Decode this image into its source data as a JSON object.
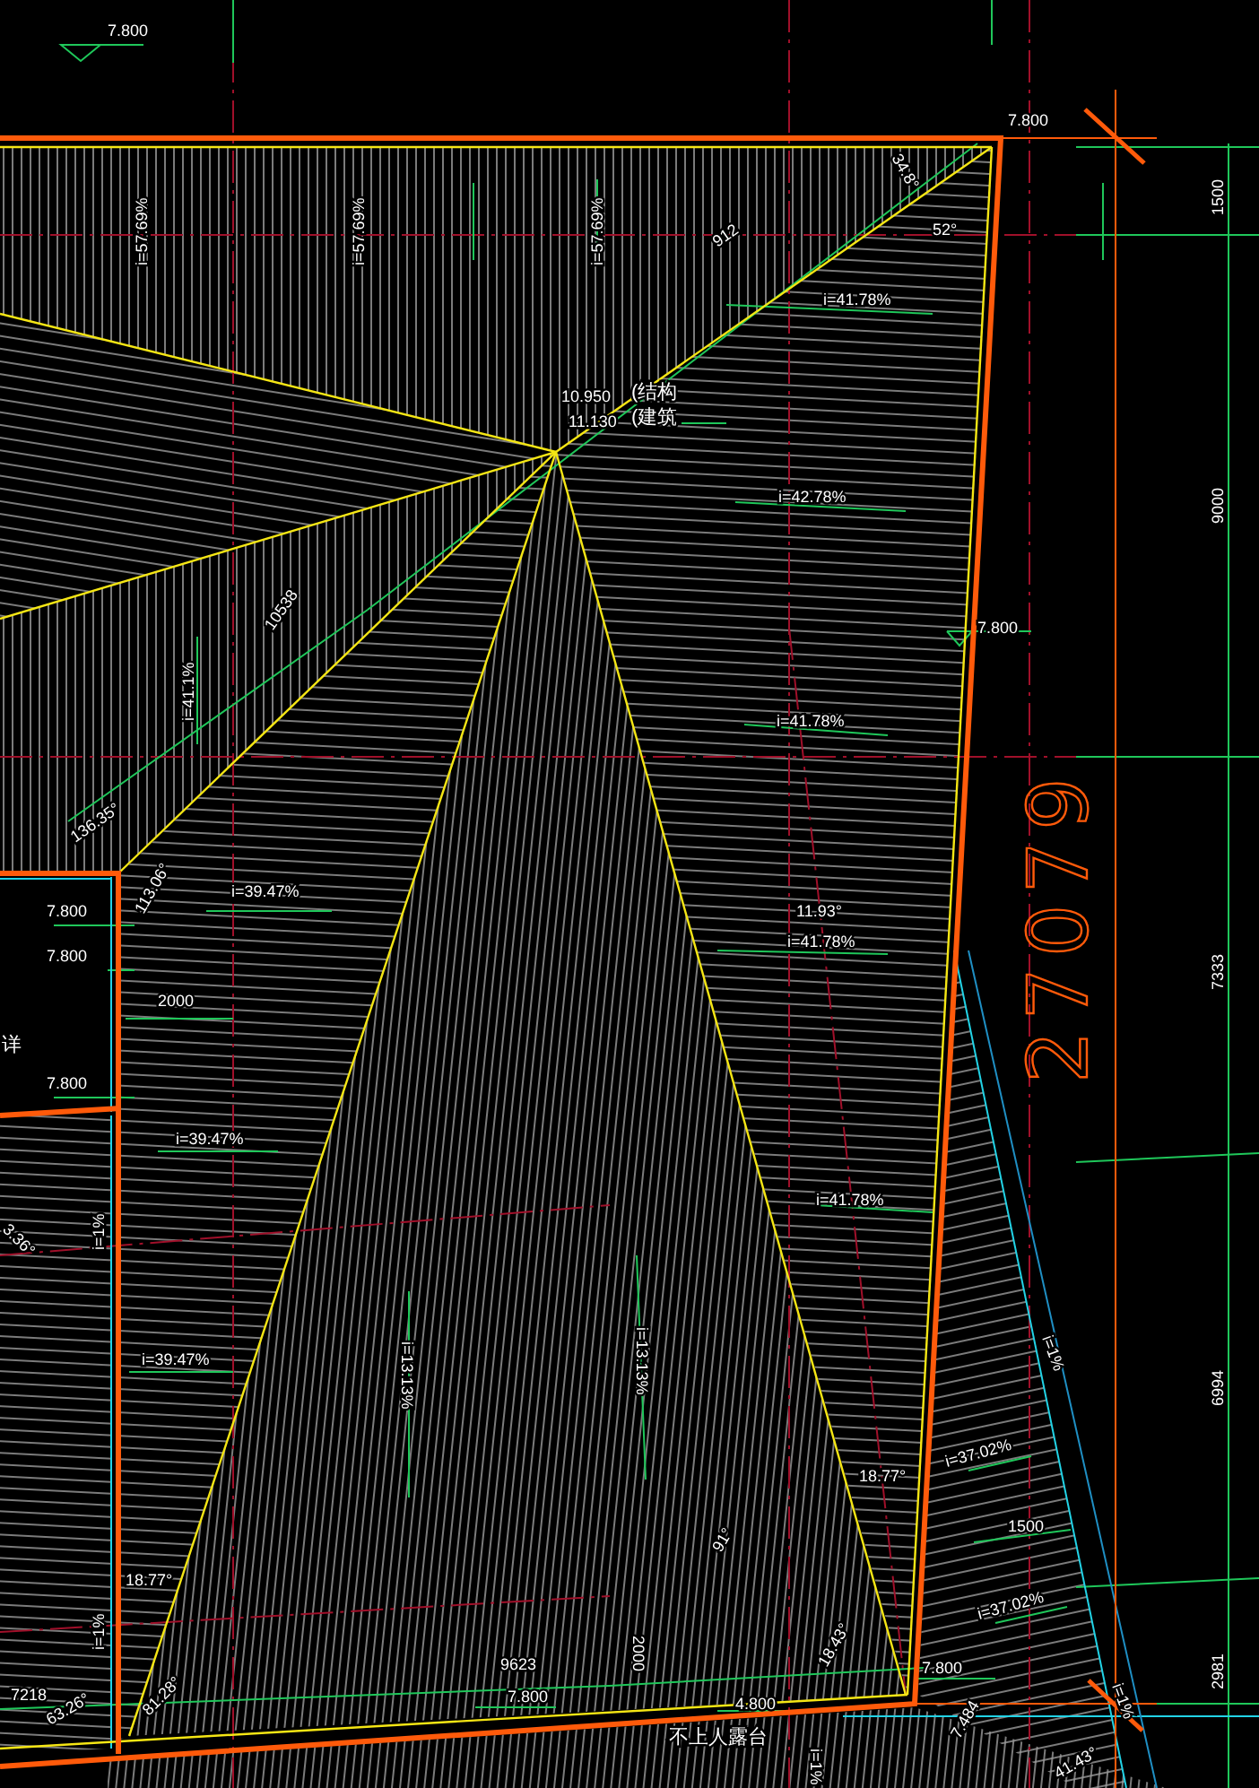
{
  "drawing": {
    "labels": [
      {
        "text": "7.800",
        "kind": "elevation"
      },
      {
        "text": "i=57.69%",
        "kind": "slope"
      },
      {
        "text": "i=57.69%",
        "kind": "slope"
      },
      {
        "text": "i=57.69%",
        "kind": "slope"
      },
      {
        "text": "912",
        "kind": "dimension"
      },
      {
        "text": "34.8°",
        "kind": "angle"
      },
      {
        "text": "52°",
        "kind": "angle"
      },
      {
        "text": "7.800",
        "kind": "elevation"
      },
      {
        "text": "1500",
        "kind": "dimension"
      },
      {
        "text": "10.950",
        "kind": "elevation"
      },
      {
        "text": "11.130",
        "kind": "elevation"
      },
      {
        "text": "(结构",
        "kind": "note"
      },
      {
        "text": "(建筑",
        "kind": "note"
      },
      {
        "text": "i=41.78%",
        "kind": "slope"
      },
      {
        "text": "i=42.78%",
        "kind": "slope"
      },
      {
        "text": "9000",
        "kind": "dimension"
      },
      {
        "text": "10538",
        "kind": "dimension"
      },
      {
        "text": "7.800",
        "kind": "elevation"
      },
      {
        "text": "i=41.1%",
        "kind": "slope"
      },
      {
        "text": "i=41.78%",
        "kind": "slope"
      },
      {
        "text": "136.35°",
        "kind": "angle"
      },
      {
        "text": "113.06°",
        "kind": "angle"
      },
      {
        "text": "i=39.47%",
        "kind": "slope"
      },
      {
        "text": "7.800",
        "kind": "elevation"
      },
      {
        "text": "7.800",
        "kind": "elevation"
      },
      {
        "text": "2000",
        "kind": "dimension"
      },
      {
        "text": "详",
        "kind": "note"
      },
      {
        "text": "11.93°",
        "kind": "angle"
      },
      {
        "text": "i=41.78%",
        "kind": "slope"
      },
      {
        "text": "27079",
        "kind": "overall_dimension"
      },
      {
        "text": "7333",
        "kind": "dimension"
      },
      {
        "text": "7.800",
        "kind": "elevation"
      },
      {
        "text": "i=39.47%",
        "kind": "slope"
      },
      {
        "text": "i=41.78%",
        "kind": "slope"
      },
      {
        "text": "3.36°",
        "kind": "angle"
      },
      {
        "text": "i=1%",
        "kind": "slope"
      },
      {
        "text": "i=39.47%",
        "kind": "slope"
      },
      {
        "text": "i=13.13%",
        "kind": "slope"
      },
      {
        "text": "i=13.13%",
        "kind": "slope"
      },
      {
        "text": "i=1%",
        "kind": "slope"
      },
      {
        "text": "6994",
        "kind": "dimension"
      },
      {
        "text": "i=37.02%",
        "kind": "slope"
      },
      {
        "text": "18.77°",
        "kind": "angle"
      },
      {
        "text": "91°",
        "kind": "angle"
      },
      {
        "text": "1500",
        "kind": "dimension"
      },
      {
        "text": "i=37.02%",
        "kind": "slope"
      },
      {
        "text": "18.77°",
        "kind": "angle"
      },
      {
        "text": "i=1%",
        "kind": "slope"
      },
      {
        "text": "9623",
        "kind": "dimension"
      },
      {
        "text": "2000",
        "kind": "dimension"
      },
      {
        "text": "18.43°",
        "kind": "angle"
      },
      {
        "text": "7.800",
        "kind": "elevation"
      },
      {
        "text": "7.800",
        "kind": "elevation"
      },
      {
        "text": "4.800",
        "kind": "elevation"
      },
      {
        "text": "7218",
        "kind": "dimension"
      },
      {
        "text": "63.26°",
        "kind": "angle"
      },
      {
        "text": "81.28°",
        "kind": "angle"
      },
      {
        "text": "不上人露台",
        "kind": "note"
      },
      {
        "text": "7.484",
        "kind": "elevation"
      },
      {
        "text": "i=1%",
        "kind": "slope"
      },
      {
        "text": "2981",
        "kind": "dimension"
      },
      {
        "text": "41.43°",
        "kind": "angle"
      },
      {
        "text": "i=1%",
        "kind": "slope"
      }
    ]
  }
}
